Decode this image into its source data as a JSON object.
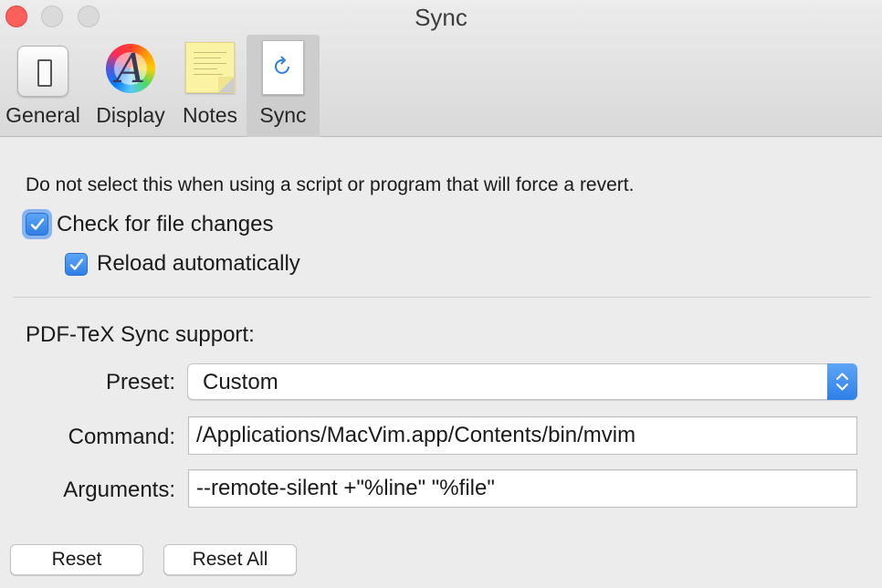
{
  "window": {
    "title": "Sync"
  },
  "toolbar": {
    "tabs": [
      {
        "label": "General",
        "icon": "switch-icon"
      },
      {
        "label": "Display",
        "icon": "color-wheel-icon"
      },
      {
        "label": "Notes",
        "icon": "note-icon"
      },
      {
        "label": "Sync",
        "icon": "sync-document-icon"
      }
    ],
    "selected": "Sync",
    "display_icon_letter": "A"
  },
  "file_changes": {
    "hint": "Do not select this when using a script or program that will force a revert.",
    "check_label": "Check for file changes",
    "check_checked": true,
    "reload_label": "Reload automatically",
    "reload_checked": true
  },
  "pdftex": {
    "section_title": "PDF-TeX Sync support:",
    "preset_label": "Preset:",
    "preset_value": "Custom",
    "command_label": "Command:",
    "command_value": "/Applications/MacVim.app/Contents/bin/mvim",
    "arguments_label": "Arguments:",
    "arguments_value": "--remote-silent +\"%line\" \"%file\""
  },
  "buttons": {
    "reset": "Reset",
    "reset_all": "Reset All"
  },
  "colors": {
    "accent": "#2f7fe6",
    "close": "#fc605c"
  }
}
